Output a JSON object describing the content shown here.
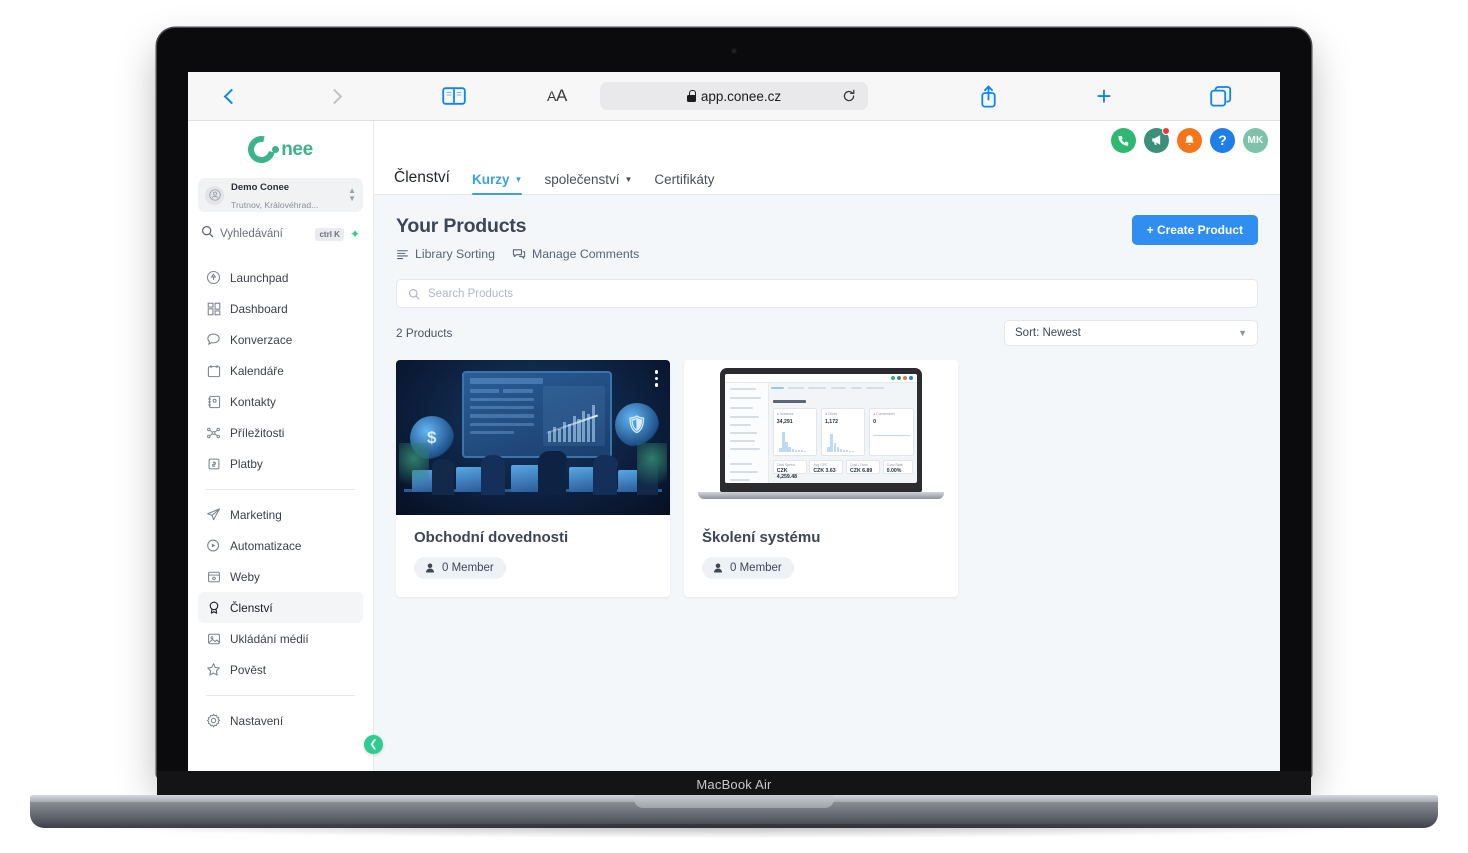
{
  "device": {
    "model_label": "MacBook Air"
  },
  "browser": {
    "back_icon": "chevron-left-icon",
    "forward_icon": "chevron-right-icon",
    "sidebar_icon": "book-icon",
    "reader_label": "AA",
    "url": "app.conee.cz",
    "lock_icon": "lock-icon",
    "reload_icon": "reload-icon",
    "share_icon": "share-icon",
    "new_tab_icon": "plus-icon",
    "tabs_icon": "tab-overview-icon"
  },
  "sidebar": {
    "logo_text": "nee",
    "account": {
      "name": "Demo Conee",
      "location": "Trutnov, Královéhrad...",
      "avatar_icon": "user-circle-icon",
      "caret_icon": "chevron-updown-icon"
    },
    "search": {
      "placeholder": "Vyhledávání",
      "shortcut": "ctrl K",
      "icon": "search-icon",
      "bolt_icon": "bolt-icon"
    },
    "groups": [
      {
        "items": [
          {
            "label": "Launchpad",
            "icon": "rocket-icon"
          },
          {
            "label": "Dashboard",
            "icon": "grid-icon"
          },
          {
            "label": "Konverzace",
            "icon": "chat-bubble-icon"
          },
          {
            "label": "Kalendáře",
            "icon": "calendar-icon"
          },
          {
            "label": "Kontakty",
            "icon": "contacts-icon"
          },
          {
            "label": "Příležitosti",
            "icon": "opportunities-icon"
          },
          {
            "label": "Platby",
            "icon": "payments-icon"
          }
        ]
      },
      {
        "items": [
          {
            "label": "Marketing",
            "icon": "paper-plane-icon"
          },
          {
            "label": "Automatizace",
            "icon": "play-circle-icon"
          },
          {
            "label": "Weby",
            "icon": "browser-window-icon"
          },
          {
            "label": "Členství",
            "icon": "award-badge-icon",
            "active": true
          },
          {
            "label": "Ukládání médií",
            "icon": "image-icon"
          },
          {
            "label": "Pověst",
            "icon": "star-icon"
          }
        ]
      },
      {
        "items": [
          {
            "label": "Nastavení",
            "icon": "gear-icon"
          }
        ]
      }
    ],
    "collapse_icon": "chevron-left-icon"
  },
  "topbar": {
    "icons": [
      {
        "name": "phone-icon",
        "glyph": "✆",
        "color": "#2eb872"
      },
      {
        "name": "megaphone-icon",
        "glyph": "὎2",
        "color": "#3c8f7a",
        "badge": true
      },
      {
        "name": "bell-icon",
        "glyph": "ὑ4",
        "color": "#f5761a"
      },
      {
        "name": "help-icon",
        "glyph": "?",
        "color": "#1e7fe8"
      }
    ],
    "avatar_initials": "MK",
    "avatar_color": "#7fc2ab"
  },
  "tabs": [
    {
      "label": "Členství",
      "primary": true
    },
    {
      "label": "Kurzy",
      "active": true,
      "caret": true
    },
    {
      "label": "společenství",
      "caret": true
    },
    {
      "label": "Certifikáty"
    }
  ],
  "page": {
    "title": "Your Products",
    "actions": [
      {
        "label": "Library Sorting",
        "icon": "sort-lines-icon"
      },
      {
        "label": "Manage Comments",
        "icon": "comments-icon"
      }
    ],
    "create_button": "+ Create Product",
    "search_placeholder": "Search Products",
    "search_icon": "search-icon",
    "count_label": "2 Products",
    "sort_label": "Sort: Newest",
    "sort_caret_icon": "chevron-down-icon"
  },
  "products": [
    {
      "title": "Obchodní dovednosti",
      "members_label": "0 Member",
      "member_icon": "person-icon",
      "menu_icon": "kebab-menu-icon",
      "thumb": "trading-room-illustration"
    },
    {
      "title": "Školení systému",
      "members_label": "0 Member",
      "member_icon": "person-icon",
      "menu_icon": "kebab-menu-icon",
      "thumb": "laptop-dashboard-screenshot"
    }
  ],
  "colors": {
    "brand_green": "#3cb38d",
    "accent_blue": "#2f8ef0",
    "tab_active": "#3ba0e0",
    "content_bg": "#f4f7fa"
  }
}
